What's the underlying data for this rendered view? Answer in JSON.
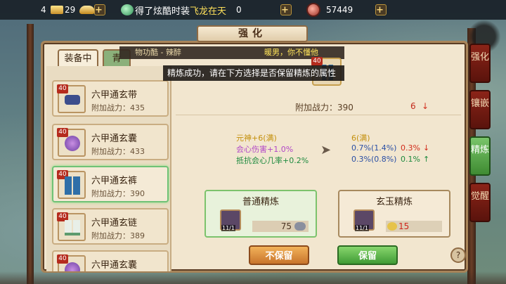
{
  "topbar": {
    "gold_count": "4",
    "ingot_count": "29",
    "marquee_prefix": "得了炫酷时装",
    "marquee_highlight": "飞龙在天",
    "jade_count": "0",
    "coin_count": "57449"
  },
  "panel": {
    "title": "强化"
  },
  "tabs": {
    "equip": "装备中",
    "second": "青"
  },
  "info_strip": {
    "left": "物功酷 - 辣醉",
    "right": "暖男，你不懂他"
  },
  "toast": "精炼成功，请在下方选择是否保留精炼的属性",
  "items": [
    {
      "level": "40",
      "name": "六甲通玄带",
      "power_label": "附加战力：435",
      "shape": "belt"
    },
    {
      "level": "40",
      "name": "六甲通玄囊",
      "power_label": "附加战力：433",
      "shape": "pouch"
    },
    {
      "level": "40",
      "name": "六甲通玄裤",
      "power_label": "附加战力：390",
      "shape": "pants"
    },
    {
      "level": "40",
      "name": "六甲通玄链",
      "power_label": "附加战力：389",
      "shape": "boots"
    },
    {
      "level": "40",
      "name": "六甲通玄囊",
      "power_label": "",
      "shape": "pouch"
    }
  ],
  "equip_icon_level": "40",
  "stats": {
    "power_label": "附加战力：390",
    "power_change": "6",
    "attrs": [
      {
        "label": "元神+6(满)",
        "new": "6(满)",
        "change": "",
        "dir": ""
      },
      {
        "label": "会心伤害+1.0%",
        "new": "0.7%(1.4%)",
        "change": "0.3%",
        "dir": "down"
      },
      {
        "label": "抵抗会心几率+0.2%",
        "new": "0.3%(0.8%)",
        "change": "0.1%",
        "dir": "up"
      }
    ]
  },
  "refine_ordinary": {
    "title": "普通精炼",
    "stone_count": "11/1",
    "cost": "75"
  },
  "refine_jade": {
    "title": "玄玉精炼",
    "stone_count": "11/1",
    "cost": "15"
  },
  "buttons": {
    "not_keep": "不保留",
    "keep": "保留",
    "help": "?"
  },
  "side_tabs": [
    {
      "label": "强化",
      "active": false
    },
    {
      "label": "镶嵌",
      "active": false
    },
    {
      "label": "精炼",
      "active": true
    },
    {
      "label": "觉醒",
      "active": false
    }
  ],
  "colors": {
    "panel_bg": "#f2e6cf",
    "active_tab": "#79c56a",
    "inactive_tab": "#8b2418",
    "down_red": "#d12b1b",
    "up_green": "#1d8a3e"
  }
}
